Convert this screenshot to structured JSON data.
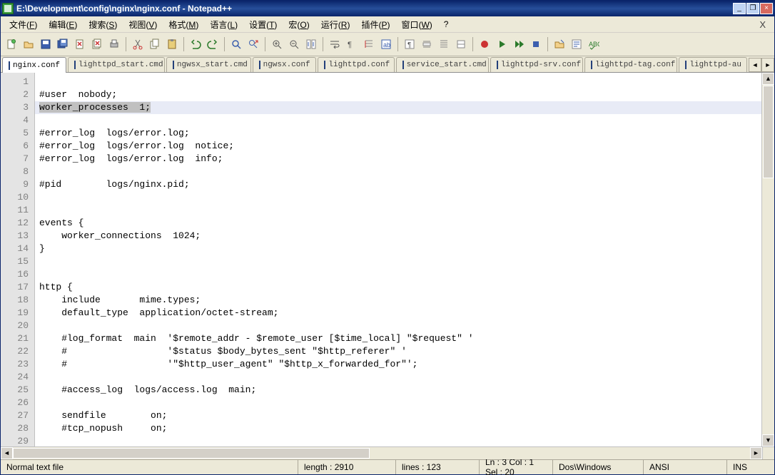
{
  "title": "E:\\Development\\config\\nginx\\nginx.conf - Notepad++",
  "menus": [
    "文件(F)",
    "编辑(E)",
    "搜索(S)",
    "视图(V)",
    "格式(M)",
    "语言(L)",
    "设置(T)",
    "宏(O)",
    "运行(R)",
    "插件(P)",
    "窗口(W)",
    "?"
  ],
  "close_doc": "X",
  "win_min": "_",
  "win_max": "❐",
  "win_close": "×",
  "toolbar_icons": [
    "new",
    "open",
    "save",
    "save-all",
    "close",
    "close-all",
    "print",
    "sep",
    "cut",
    "copy",
    "paste",
    "sep",
    "undo",
    "redo",
    "sep",
    "find",
    "replace",
    "sep",
    "zoom-in",
    "zoom-out",
    "sync-v",
    "sep",
    "wrap",
    "all-chars",
    "indent-guide",
    "lang",
    "sep",
    "pilcrow",
    "fold",
    "unfold",
    "toggle",
    "sep",
    "rec",
    "play",
    "play-multi",
    "stop",
    "sep",
    "open-explorer",
    "function-list",
    "spell"
  ],
  "tabs": [
    {
      "label": "nginx.conf",
      "active": true,
      "unsaved": false
    },
    {
      "label": "lighttpd_start.cmd",
      "active": false,
      "unsaved": false
    },
    {
      "label": "ngwsx_start.cmd",
      "active": false,
      "unsaved": false
    },
    {
      "label": "ngwsx.conf",
      "active": false,
      "unsaved": false
    },
    {
      "label": "lighttpd.conf",
      "active": false,
      "unsaved": false
    },
    {
      "label": "service_start.cmd",
      "active": false,
      "unsaved": false
    },
    {
      "label": "lighttpd-srv.conf",
      "active": false,
      "unsaved": false
    },
    {
      "label": "lighttpd-tag.conf",
      "active": false,
      "unsaved": false
    },
    {
      "label": "lighttpd-au",
      "active": false,
      "unsaved": false
    }
  ],
  "tab_nav_prev": "◄",
  "tab_nav_next": "►",
  "code_lines": [
    "",
    "#user  nobody;",
    "worker_processes  1;",
    "",
    "#error_log  logs/error.log;",
    "#error_log  logs/error.log  notice;",
    "#error_log  logs/error.log  info;",
    "",
    "#pid        logs/nginx.pid;",
    "",
    "",
    "events {",
    "    worker_connections  1024;",
    "}",
    "",
    "",
    "http {",
    "    include       mime.types;",
    "    default_type  application/octet-stream;",
    "",
    "    #log_format  main  '$remote_addr - $remote_user [$time_local] \"$request\" '",
    "    #                  '$status $body_bytes_sent \"$http_referer\" '",
    "    #                  '\"$http_user_agent\" \"$http_x_forwarded_for\"';",
    "",
    "    #access_log  logs/access.log  main;",
    "",
    "    sendfile        on;",
    "    #tcp_nopush     on;",
    ""
  ],
  "current_line_index": 2,
  "current_sel_chars": 20,
  "status": {
    "filetype": "Normal text file",
    "length_label": "length : 2910",
    "lines_label": "lines : 123",
    "pos_label": "Ln : 3    Col : 1    Sel : 20",
    "eol": "Dos\\Windows",
    "encoding": "ANSI",
    "mode": "INS"
  }
}
